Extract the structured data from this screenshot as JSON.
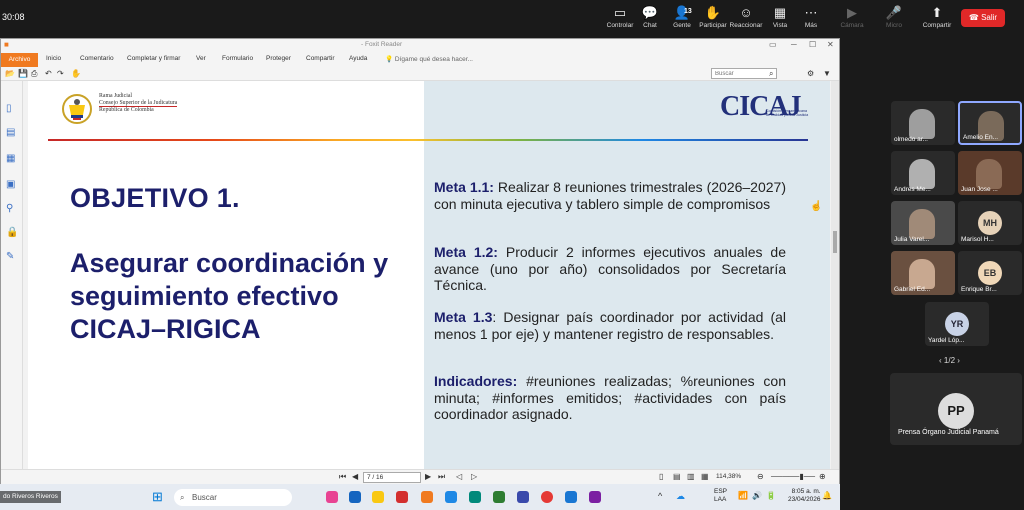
{
  "zoom": {
    "time": "30:08",
    "buttons": [
      {
        "icon": "▭",
        "label": "Controlar"
      },
      {
        "icon": "💬",
        "label": "Chat"
      },
      {
        "icon": "👤",
        "label": "Gente"
      },
      {
        "icon": "✋",
        "label": "Participar"
      },
      {
        "icon": "☺",
        "label": "Reaccionar"
      },
      {
        "icon": "▦",
        "label": "Vista"
      },
      {
        "icon": "⋯",
        "label": "Más"
      },
      {
        "icon": "▶",
        "label": "Cámara"
      },
      {
        "icon": "🎤",
        "label": "Micro"
      },
      {
        "icon": "⬆",
        "label": "Compartir"
      }
    ],
    "people_count": "13",
    "leave": "Salir"
  },
  "foxit": {
    "title": "- Foxit Reader",
    "menu": [
      "Archivo",
      "Inicio",
      "Comentario",
      "Completar y firmar",
      "Ver",
      "Formulario",
      "Proteger",
      "Compartir",
      "Ayuda"
    ],
    "tellme": "Dígame qué desea hacer...",
    "search_placeholder": "Buscar",
    "page_indicator": "7 / 16",
    "zoom": "114,38%"
  },
  "slide": {
    "header_org": [
      "Rama Judicial",
      "Consejo Superior de la Judicatura",
      "República de Colombia"
    ],
    "logo": "CICAJ",
    "logo_sub": "Comisión Iberoamericana de Calidad para la Justicia",
    "objective_title": "OBJETIVO 1.",
    "objective_text": "Asegurar coordinación y seguimiento efectivo CICAJ–RIGICA",
    "metas": [
      {
        "label": "Meta 1.1:",
        "text": " Realizar 8 reuniones trimestrales (2026–2027) con minuta ejecutiva y tablero simple de compromisos"
      },
      {
        "label": "Meta 1.2:",
        "text": " Producir 2 informes ejecutivos anuales de avance (uno por año) consolidados por Secretaría Técnica."
      },
      {
        "label": "Meta 1.3",
        "text": ": Designar país coordinador por actividad (al menos 1 por eje) y mantener registro de responsables."
      },
      {
        "label": "Indicadores:",
        "text": " #reuniones realizadas; %reuniones con minuta; #informes emitidos; #actividades con país coordinador asignado."
      }
    ]
  },
  "taskbar": {
    "search": "Buscar",
    "lang": "ESP",
    "lang2": "LAA",
    "time": "8:05 a. m.",
    "date": "23/04/2026",
    "speaker": "do Riveros Riveros"
  },
  "participants": [
    {
      "name": "olmedo ar..."
    },
    {
      "name": "Amelio En..."
    },
    {
      "name": "Andres Me..."
    },
    {
      "name": "Juan Jose ..."
    },
    {
      "name": "Julia Varel..."
    },
    {
      "name": "Marisol H...",
      "initials": "MH"
    },
    {
      "name": "Gabriel Ed..."
    },
    {
      "name": "Enrique Br...",
      "initials": "EB"
    },
    {
      "name": "Yardel Lóp...",
      "initials": "YR"
    }
  ],
  "pager": "1/2",
  "featured": {
    "initials": "PP",
    "name": "Prensa Órgano Judicial Panamá"
  },
  "colors": {
    "accent": "#1c1f6b",
    "leave": "#e02828",
    "foxit_orange": "#f07a20",
    "panel": "#dde8ee"
  }
}
